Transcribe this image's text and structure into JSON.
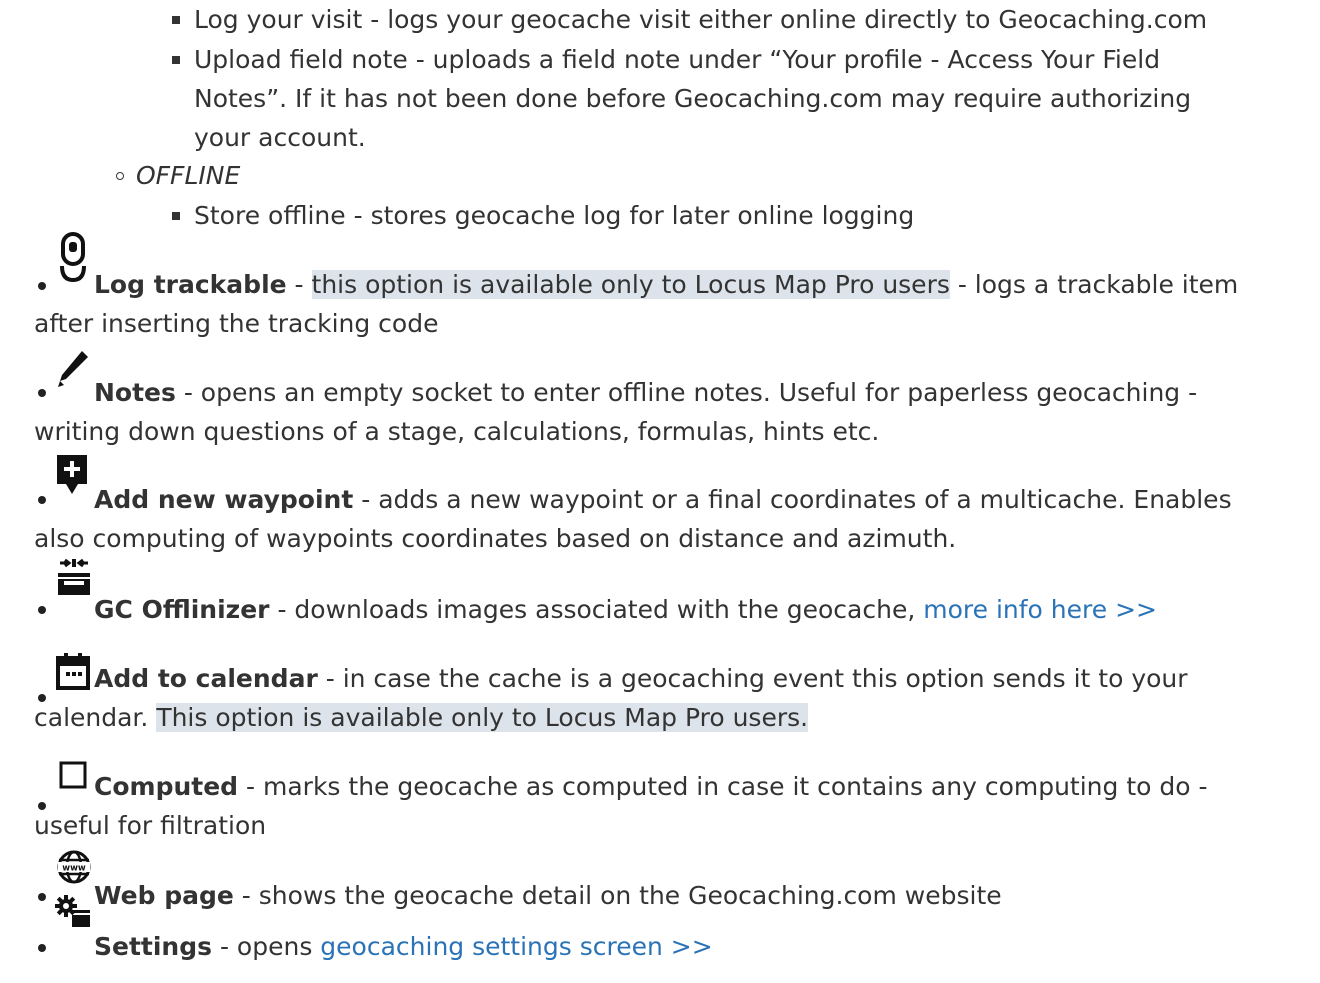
{
  "sub_online": [
    "Log your visit - logs your geocache visit either online directly to Geocaching.com",
    "Upload field note - uploads a field note under “Your profile - Access Your Field",
    "Notes”. If it has not been done before Geocaching.com may require authorizing",
    "your account."
  ],
  "offline_label": "OFFLINE",
  "sub_offline": [
    "Store offline - stores geocache log for later online logging"
  ],
  "items": [
    {
      "icon": "trackable-icon",
      "bold": "Log trackable",
      "sep": " - ",
      "highlight": "this option is available only to Locus Map Pro users",
      "rest": " - logs a trackable item",
      "line2": "after inserting the tracking code"
    },
    {
      "icon": "pencil-icon",
      "bold": "Notes",
      "rest": " - opens an empty socket to enter offline notes. Useful for paperless geocaching -",
      "line2": "writing down questions of a stage, calculations, formulas, hints etc."
    },
    {
      "icon": "add-waypoint-icon",
      "bold": "Add new waypoint",
      "rest": " - adds a new waypoint or a final coordinates of a multicache. Enables",
      "line2": "also computing of waypoints coordinates based on distance and azimuth."
    },
    {
      "icon": "offlinizer-icon",
      "bold": "GC Offlinizer",
      "rest": " - downloads images associated with the geocache, ",
      "link": "more info here >>"
    },
    {
      "icon": "calendar-icon",
      "bold": "Add to calendar",
      "rest": " - in case the cache is a geocaching event this option sends it to your",
      "line2_prefix": "calendar. ",
      "line2_highlight": "This option is available only to Locus Map Pro users."
    },
    {
      "icon": "checkbox-icon",
      "bold": "Computed",
      "rest": " - marks the geocache as computed in case it contains any computing to do -",
      "line2": "useful for filtration"
    },
    {
      "icon": "globe-www-icon",
      "bold": "Web page",
      "rest": " - shows the geocache detail on the Geocaching.com website"
    },
    {
      "icon": "settings-icon",
      "bold": "Settings",
      "rest": " - opens ",
      "link": "geocaching settings screen >>"
    }
  ],
  "colors": {
    "text": "#333333",
    "link": "#2b73b7",
    "highlight": "#dde3ea"
  }
}
